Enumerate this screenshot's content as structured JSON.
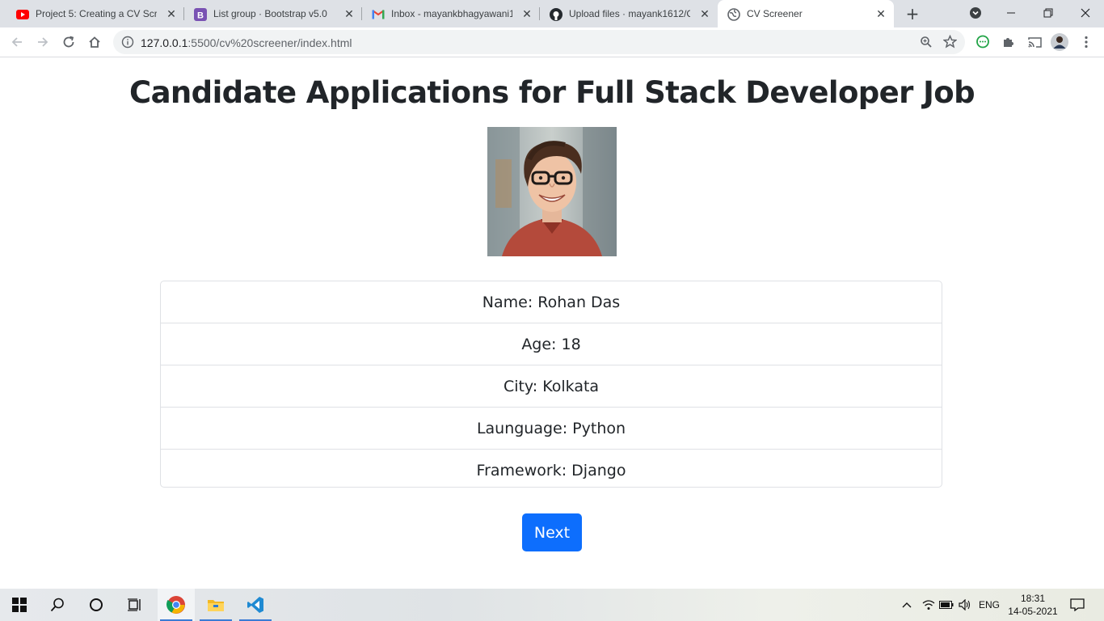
{
  "browser": {
    "tabs": [
      {
        "title": "Project 5: Creating a CV Scree",
        "favicon": "youtube-icon"
      },
      {
        "title": "List group · Bootstrap v5.0",
        "favicon": "bootstrap-icon"
      },
      {
        "title": "Inbox - mayankbhagyawani10",
        "favicon": "gmail-icon"
      },
      {
        "title": "Upload files · mayank1612/CV",
        "favicon": "github-icon"
      },
      {
        "title": "CV Screener",
        "favicon": "globe-icon",
        "active": true
      }
    ],
    "new_tab_label": "+",
    "address": {
      "host": "127.0.0.1",
      "path": ":5500/cv%20screener/index.html"
    }
  },
  "page": {
    "heading": "Candidate Applications for Full Stack Developer Job",
    "candidate": {
      "fields": [
        "Name: Rohan Das",
        "Age: 18",
        "City: Kolkata",
        "Launguage: Python",
        "Framework: Django"
      ]
    },
    "next_button": "Next"
  },
  "taskbar": {
    "language": "ENG",
    "time": "18:31",
    "date": "14-05-2021"
  },
  "colors": {
    "primary_button": "#0d6efd",
    "tabstrip": "#dee1e6",
    "text": "#212529"
  }
}
